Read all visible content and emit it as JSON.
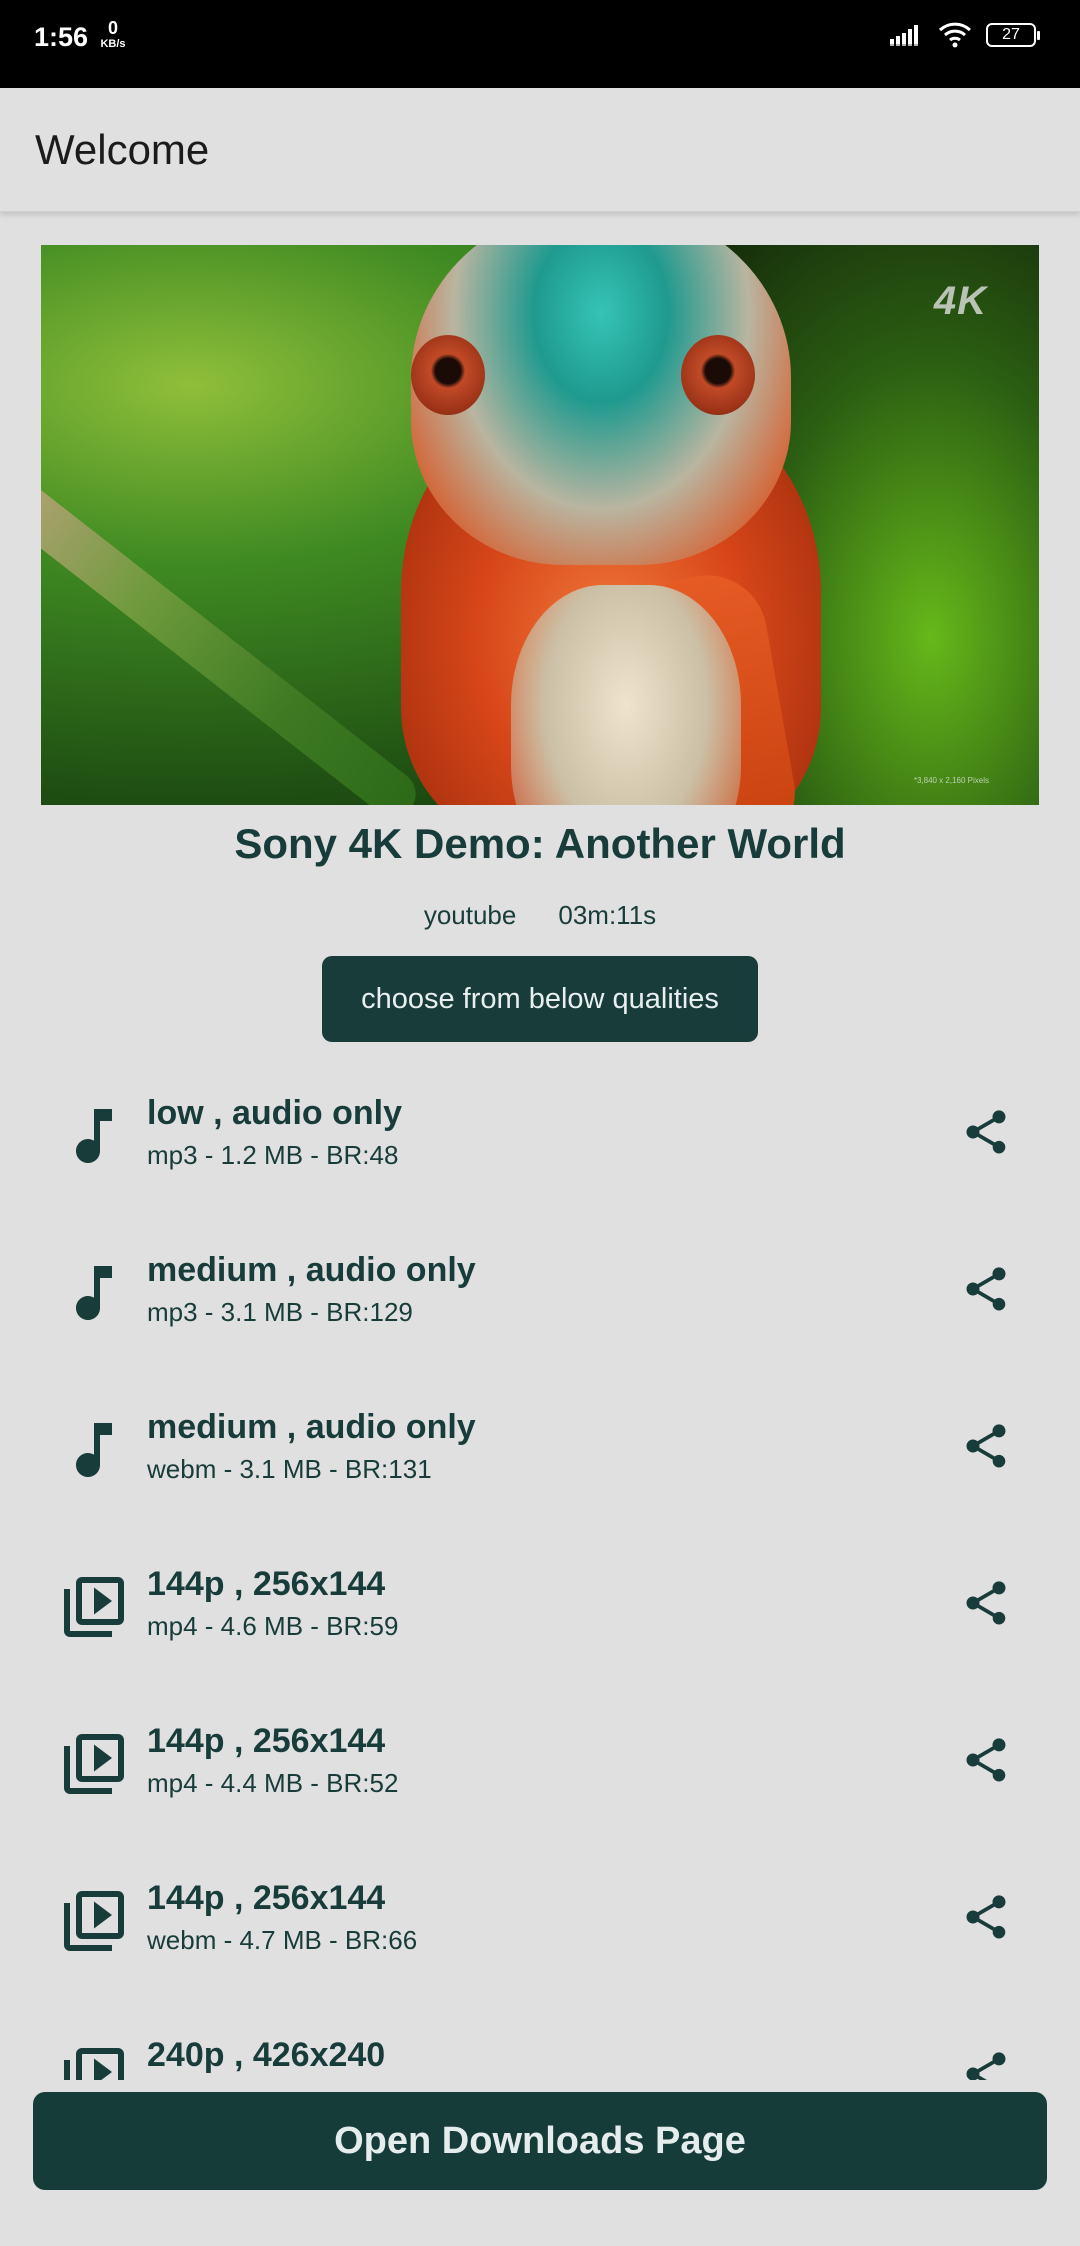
{
  "status_bar": {
    "time": "1:56",
    "net_speed_value": "0",
    "net_speed_unit": "KB/s",
    "battery": "27"
  },
  "app_bar": {
    "title": "Welcome"
  },
  "video": {
    "thumbnail_badge": "4K",
    "thumbnail_caption": "*3,840 x 2,160 Pixels",
    "title": "Sony 4K Demo: Another World",
    "source": "youtube",
    "duration": "03m:11s"
  },
  "choose_button_label": "choose from below qualities",
  "qualities": [
    {
      "icon": "music-note-icon",
      "title": "low , audio only",
      "details": "mp3 - 1.2 MB - BR:48"
    },
    {
      "icon": "music-note-icon",
      "title": "medium , audio only",
      "details": "mp3 - 3.1 MB - BR:129"
    },
    {
      "icon": "music-note-icon",
      "title": "medium , audio only",
      "details": "webm - 3.1 MB - BR:131"
    },
    {
      "icon": "video-library-icon",
      "title": "144p , 256x144",
      "details": "mp4 - 4.6 MB - BR:59"
    },
    {
      "icon": "video-library-icon",
      "title": "144p , 256x144",
      "details": "mp4 - 4.4 MB - BR:52"
    },
    {
      "icon": "video-library-icon",
      "title": "144p , 256x144",
      "details": "webm - 4.7 MB - BR:66"
    },
    {
      "icon": "video-library-icon",
      "title": "240p , 426x240",
      "details": ""
    }
  ],
  "open_downloads_label": "Open Downloads Page",
  "colors": {
    "primary_dark": "#173c3a",
    "background": "#e0e0e0",
    "status_bar": "#000000"
  }
}
